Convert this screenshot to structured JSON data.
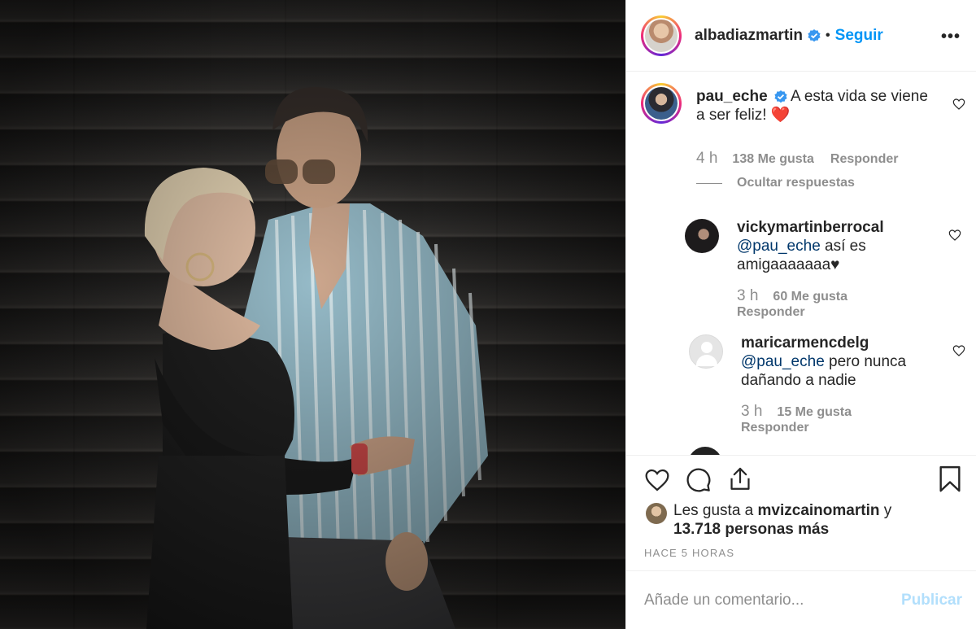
{
  "post": {
    "author": "albadiazmartin",
    "follow_label": "Seguir",
    "separator": "•",
    "more_icon": "more-horizontal-icon"
  },
  "caption": {
    "username": "pau_eche",
    "text": "A esta vida se viene a ser feliz! ❤️",
    "time": "4 h",
    "likes": "138 Me gusta",
    "reply_label": "Responder",
    "hide_replies": "Ocultar respuestas"
  },
  "replies": [
    {
      "username": "vickymartinberrocal",
      "mention": "@pau_eche",
      "text": " así es amigaaaaaaa♥",
      "time": "3 h",
      "likes": "60 Me gusta",
      "reply_label": "Responder"
    },
    {
      "username": "maricarmencdelg",
      "mention": "@pau_eche",
      "text": " pero nunca dañando a nadie",
      "time": "3 h",
      "likes": "15 Me gusta",
      "reply_label": "Responder"
    }
  ],
  "liked_by": {
    "prefix": "Les gusta a ",
    "user": "mvizcainomartin",
    "conj": " y",
    "others": "13.718 personas más"
  },
  "timestamp": "HACE 5 HORAS",
  "comment_input": {
    "placeholder": "Añade un comentario...",
    "publish_label": "Publicar"
  },
  "colors": {
    "link": "#0095f6",
    "verified": "#3897f0",
    "publish_disabled": "#b2dffc",
    "muted": "#8e8e8e"
  }
}
